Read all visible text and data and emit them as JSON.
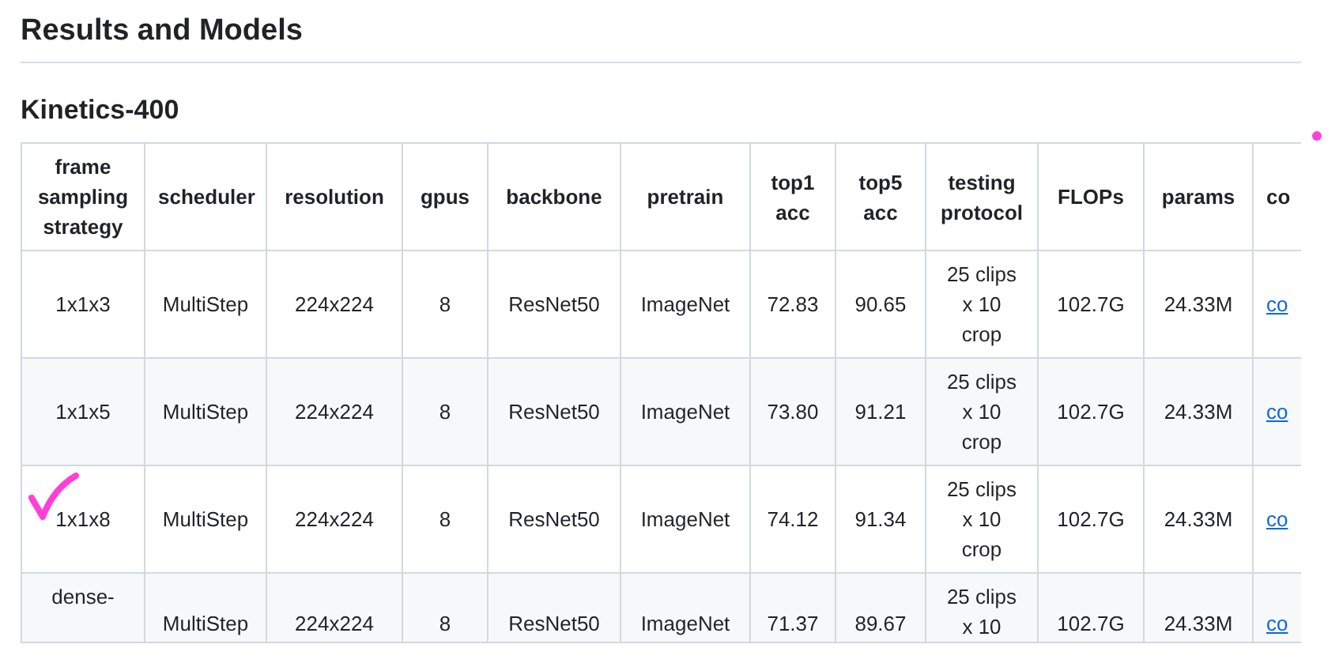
{
  "heading": "Results and Models",
  "subheading": "Kinetics-400",
  "table": {
    "columns": [
      "frame sampling strategy",
      "scheduler",
      "resolution",
      "gpus",
      "backbone",
      "pretrain",
      "top1 acc",
      "top5 acc",
      "testing protocol",
      "FLOPs",
      "params",
      "co"
    ],
    "rows": [
      {
        "marked": false,
        "cells": [
          "1x1x3",
          "MultiStep",
          "224x224",
          "8",
          "ResNet50",
          "ImageNet",
          "72.83",
          "90.65",
          "25 clips x 10 crop",
          "102.7G",
          "24.33M",
          "co"
        ]
      },
      {
        "marked": false,
        "cells": [
          "1x1x5",
          "MultiStep",
          "224x224",
          "8",
          "ResNet50",
          "ImageNet",
          "73.80",
          "91.21",
          "25 clips x 10 crop",
          "102.7G",
          "24.33M",
          "co"
        ]
      },
      {
        "marked": true,
        "cells": [
          "1x1x8",
          "MultiStep",
          "224x224",
          "8",
          "ResNet50",
          "ImageNet",
          "74.12",
          "91.34",
          "25 clips x 10 crop",
          "102.7G",
          "24.33M",
          "co"
        ]
      },
      {
        "marked": false,
        "cells": [
          "dense-",
          "MultiStep",
          "224x224",
          "8",
          "ResNet50",
          "ImageNet",
          "71.37",
          "89.67",
          "25 clips x 10",
          "102.7G",
          "24.33M",
          "co"
        ]
      }
    ]
  }
}
